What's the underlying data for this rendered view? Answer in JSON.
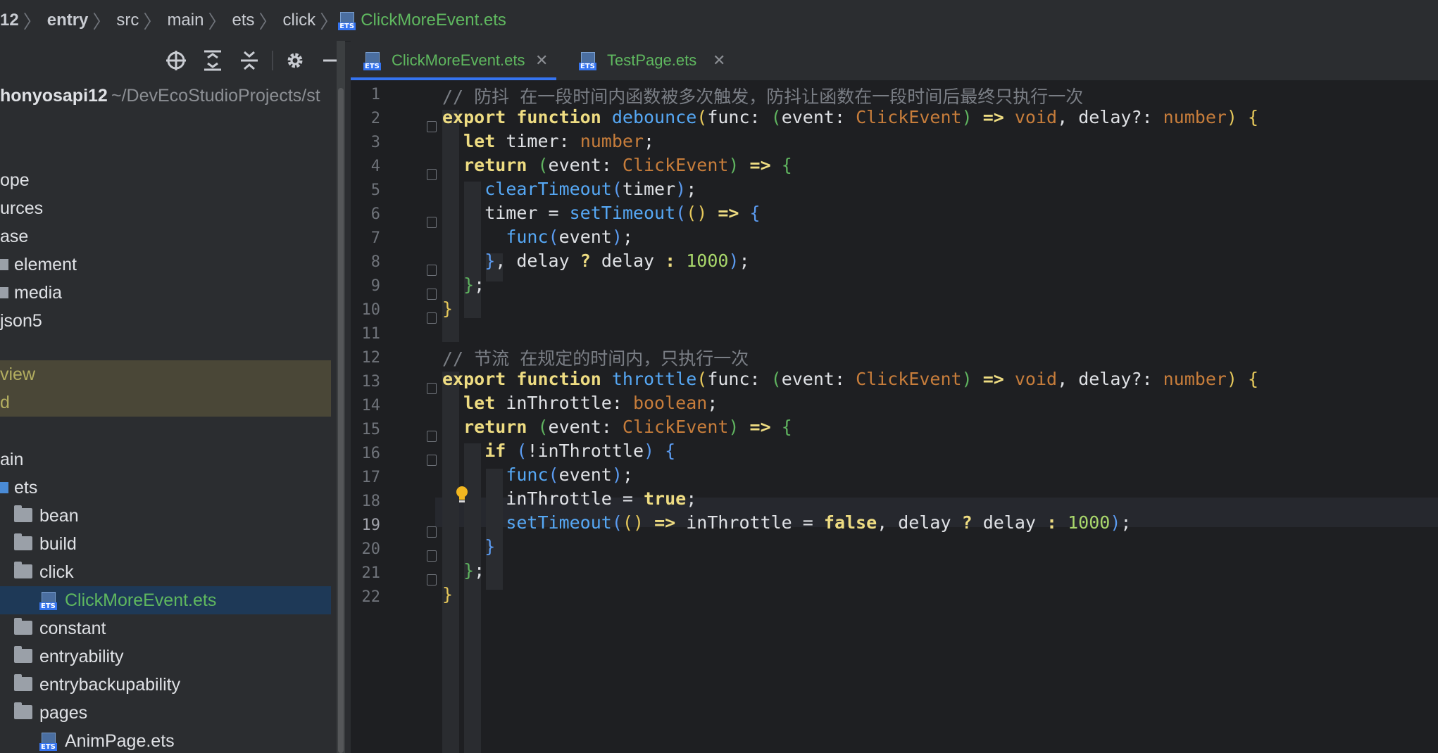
{
  "breadcrumb": {
    "segments": [
      "12",
      "entry",
      "src",
      "main",
      "ets",
      "click"
    ],
    "file": "ClickMoreEvent.ets",
    "file_icon": "ets-file-icon"
  },
  "project_panel": {
    "root_label": "honyosapi12",
    "root_path": "~/DevEcoStudioProjects/st",
    "tree": [
      {
        "label": "ope",
        "kind": "text"
      },
      {
        "label": "urces",
        "kind": "text"
      },
      {
        "label": "ase",
        "kind": "text"
      },
      {
        "label": "element",
        "kind": "folder-partial"
      },
      {
        "label": "media",
        "kind": "folder-partial"
      },
      {
        "label": "json5",
        "kind": "text"
      },
      {
        "label": "view",
        "kind": "highlight"
      },
      {
        "label": "d",
        "kind": "highlight"
      },
      {
        "label": "ain",
        "kind": "text"
      },
      {
        "label": "ets",
        "kind": "folder-blue-partial"
      },
      {
        "label": "bean",
        "kind": "folder"
      },
      {
        "label": "build",
        "kind": "folder"
      },
      {
        "label": "click",
        "kind": "folder"
      },
      {
        "label": "ClickMoreEvent.ets",
        "kind": "file-selected"
      },
      {
        "label": "constant",
        "kind": "folder"
      },
      {
        "label": "entryability",
        "kind": "folder"
      },
      {
        "label": "entrybackupability",
        "kind": "folder"
      },
      {
        "label": "pages",
        "kind": "folder"
      },
      {
        "label": "AnimPage.ets",
        "kind": "file"
      }
    ]
  },
  "tabs": [
    {
      "label": "ClickMoreEvent.ets",
      "active": true
    },
    {
      "label": "TestPage.ets",
      "active": false
    }
  ],
  "editor": {
    "current_line": 19,
    "line_numbers": [
      "1",
      "2",
      "3",
      "4",
      "5",
      "6",
      "7",
      "8",
      "9",
      "10",
      "11",
      "12",
      "13",
      "14",
      "15",
      "16",
      "17",
      "18",
      "19",
      "20",
      "21",
      "22"
    ],
    "comment_debounce": "// 防抖 在一段时间内函数被多次触发，防抖让函数在一段时间后最终只执行一次",
    "comment_throttle": "// 节流 在规定的时间内，只执行一次"
  },
  "colors": {
    "keyword": "#eedc82",
    "function": "#56a8f5",
    "type": "#c77d3b",
    "number": "#a9d76b",
    "comment": "#7a7e85",
    "file_green": "#5fb85f",
    "selection": "#1e3957"
  }
}
